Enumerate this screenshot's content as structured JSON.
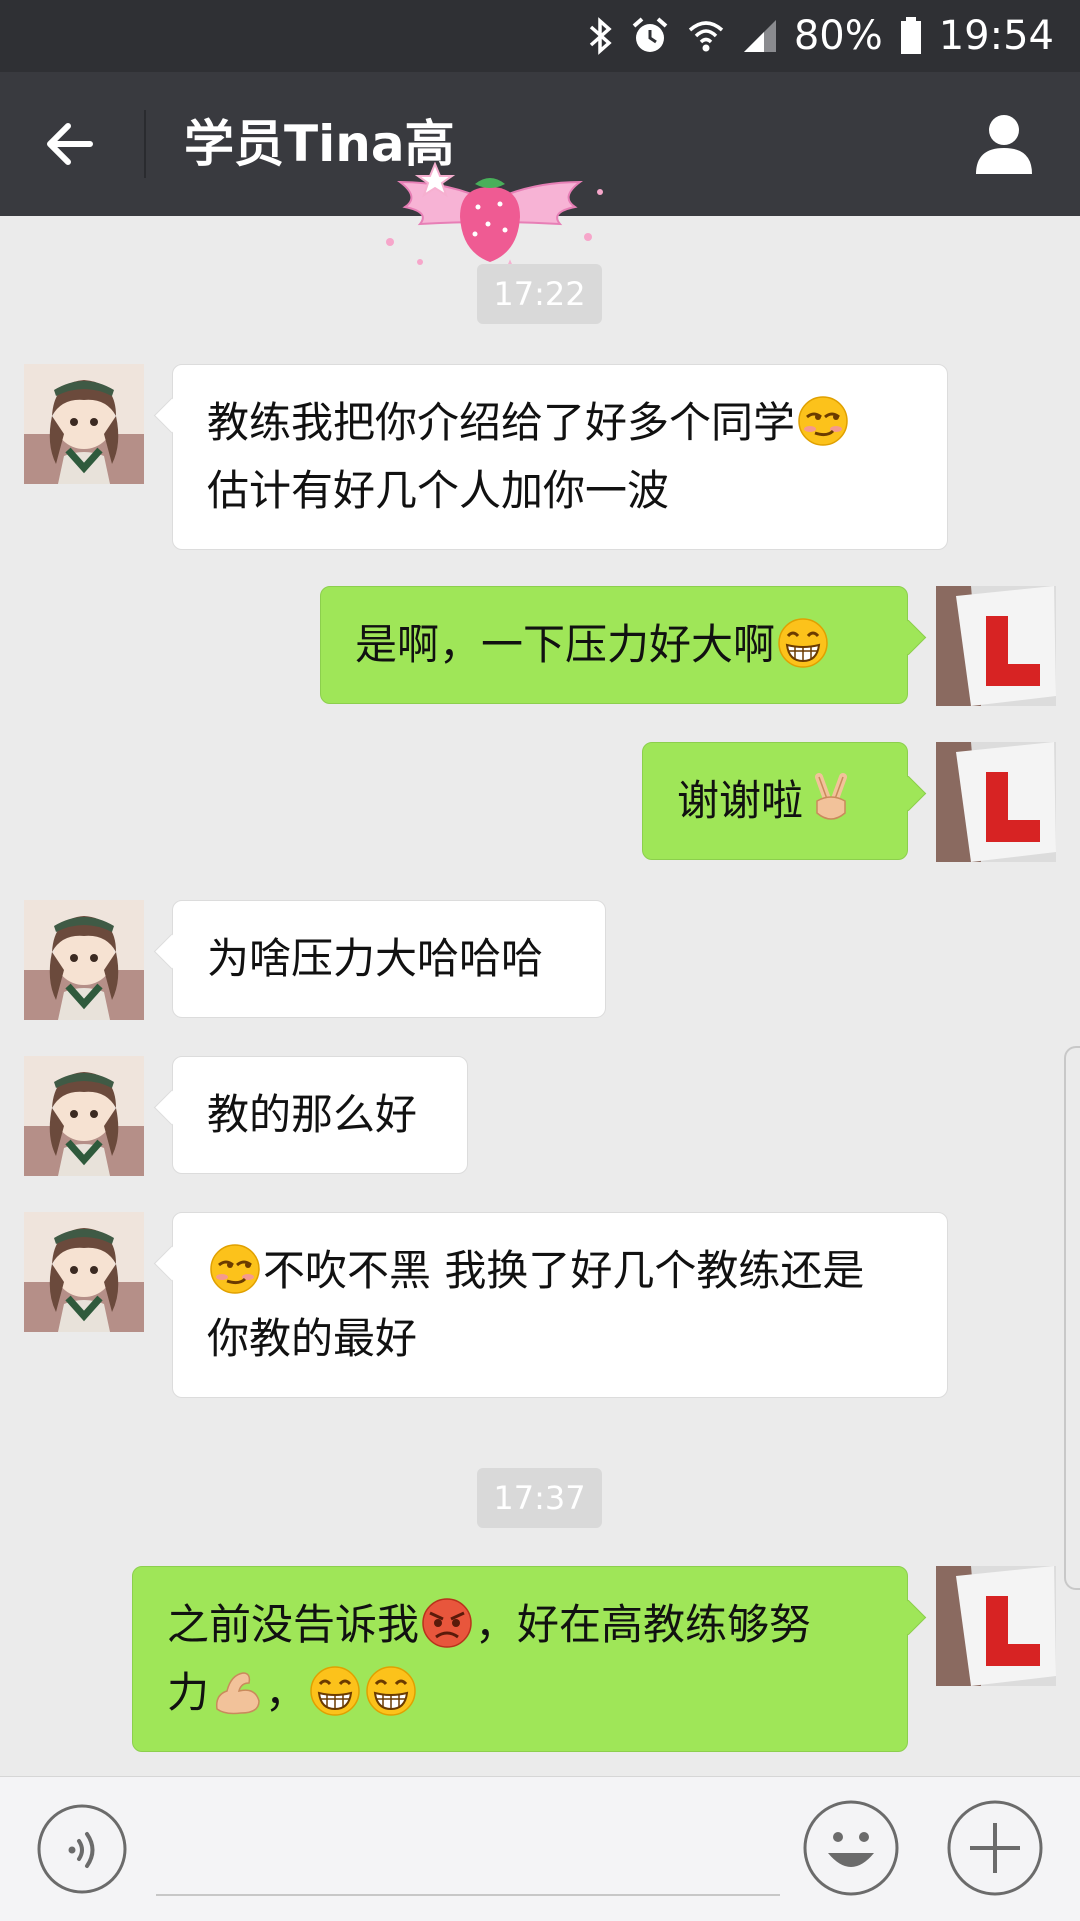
{
  "status_bar": {
    "battery": "80%",
    "time": "19:54"
  },
  "header": {
    "title": "学员Tina高"
  },
  "messages": [
    {
      "type": "time",
      "text": "17:22"
    },
    {
      "side": "in",
      "text": "教练我把你介绍给了好多个同学",
      "emoji": "smirk-emoji",
      "text2": "估计有好几个人加你一波"
    },
    {
      "side": "out",
      "text": "是啊，一下压力好大啊",
      "emoji": "grin-emoji"
    },
    {
      "side": "out",
      "text": "谢谢啦",
      "emoji": "victory-hand-emoji"
    },
    {
      "side": "in",
      "text": "为啥压力大哈哈哈"
    },
    {
      "side": "in",
      "text": "教的那么好"
    },
    {
      "side": "in",
      "emoji": "smirk-emoji",
      "text": "不吹不黑 我换了好几个教练还是",
      "text2": "你教的最好"
    },
    {
      "type": "time",
      "text": "17:37"
    },
    {
      "side": "out",
      "text": "之前没告诉我",
      "emoji": "angry-emoji",
      "text_b": "，好在高教练够努",
      "text2": "力",
      "emoji2": "flexed-biceps-emoji",
      "text2_b": "，",
      "emoji3": "grin-emoji"
    }
  ],
  "colors": {
    "outgoing": "#9fe658",
    "incoming": "#ffffff",
    "header": "#393a3f",
    "background": "#ebebeb"
  }
}
